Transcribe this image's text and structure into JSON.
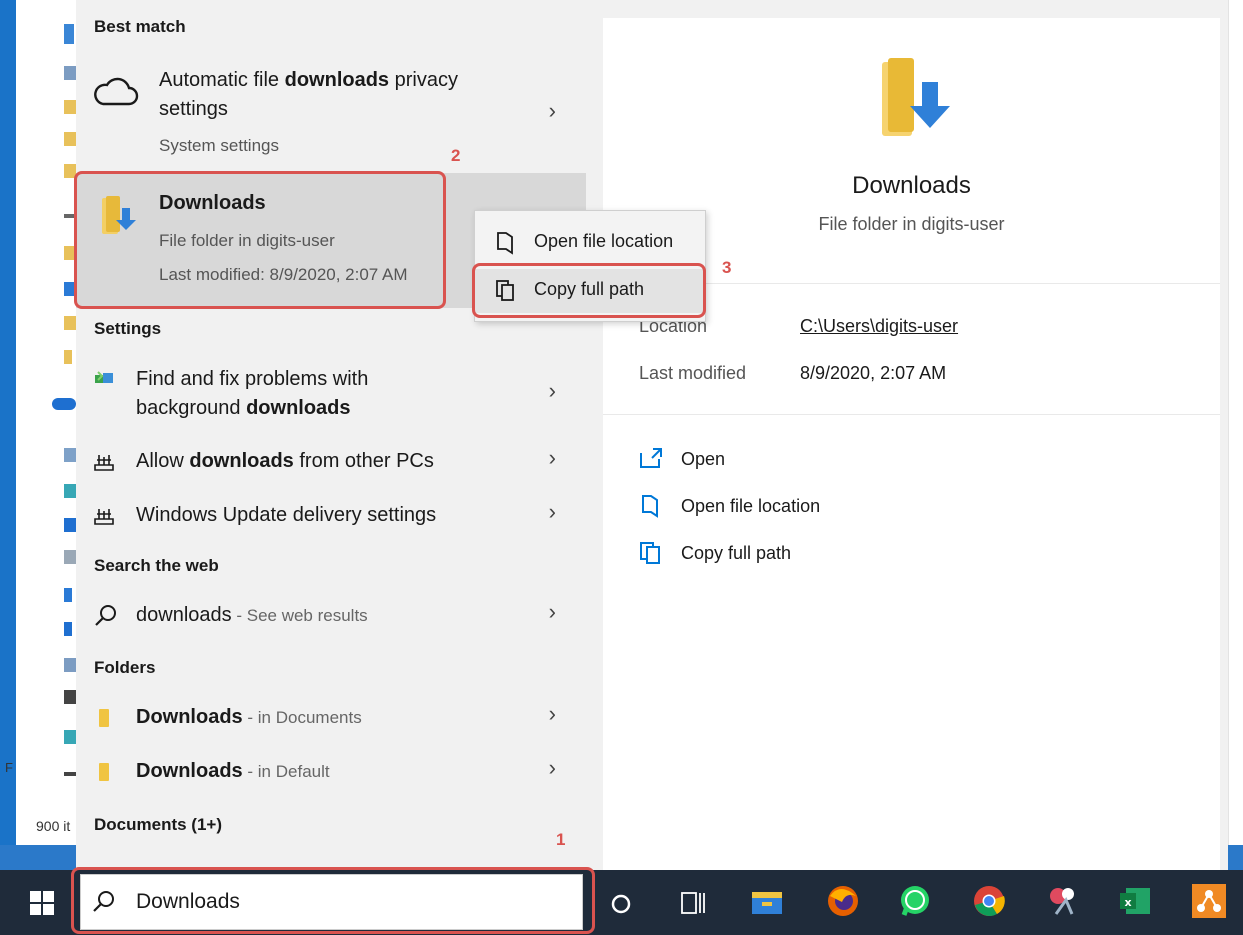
{
  "background": {
    "status_text": "900 it",
    "left_letter": "F"
  },
  "best_match": {
    "header": "Best match",
    "item1": {
      "title_pre": "Automatic file ",
      "title_bold": "downloads",
      "title_post": " privacy",
      "title_line2": "settings",
      "subtitle": "System settings",
      "icon": "cloud-icon"
    },
    "item2": {
      "title": "Downloads",
      "subtitle": "File folder in digits-user",
      "modified": "Last modified: 8/9/2020, 2:07 AM",
      "icon": "downloads-folder-icon"
    }
  },
  "settings": {
    "header": "Settings",
    "items": [
      {
        "pre": "Find and fix problems with",
        "line2_pre": "background ",
        "line2_bold": "downloads",
        "icon": "troubleshoot-icon"
      },
      {
        "pre": "Allow ",
        "bold": "downloads",
        "post": " from other PCs",
        "icon": "delivery-icon"
      },
      {
        "pre": "Windows Update delivery settings",
        "icon": "delivery-icon"
      }
    ]
  },
  "web": {
    "header": "Search the web",
    "query": "downloads",
    "hint": " - See web results"
  },
  "folders": {
    "header": "Folders",
    "items": [
      {
        "name": "Downloads",
        "hint": " - in Documents"
      },
      {
        "name": "Downloads",
        "hint": " - in Default"
      }
    ]
  },
  "documents": {
    "header": "Documents (1+)"
  },
  "context_menu": {
    "items": [
      {
        "label": "Open file location",
        "icon": "folder-location-icon"
      },
      {
        "label": "Copy full path",
        "icon": "copy-path-icon"
      }
    ]
  },
  "preview": {
    "name": "Downloads",
    "type": "File folder in digits-user",
    "location_label": "Location",
    "location_value": "C:\\Users\\digits-user",
    "modified_label": "Last modified",
    "modified_value": "8/9/2020, 2:07 AM",
    "actions": [
      {
        "label": "Open",
        "icon": "open-icon"
      },
      {
        "label": "Open file location",
        "icon": "folder-location-icon"
      },
      {
        "label": "Copy full path",
        "icon": "copy-path-icon"
      }
    ]
  },
  "taskbar": {
    "search_value": "Downloads",
    "apps": [
      "windows-start-icon",
      "cortana-icon",
      "task-view-icon",
      "file-explorer-icon",
      "firefox-icon",
      "whatsapp-icon",
      "chrome-icon",
      "snipping-tool-icon",
      "excel-icon",
      "app-icon"
    ]
  },
  "annotations": {
    "step1": "1",
    "step2": "2",
    "step3": "3"
  },
  "colors": {
    "accent": "#0078d7",
    "annotation_red": "#d9534f",
    "taskbar": "#1f2b3a",
    "menu_bg": "#f1f1f1"
  }
}
